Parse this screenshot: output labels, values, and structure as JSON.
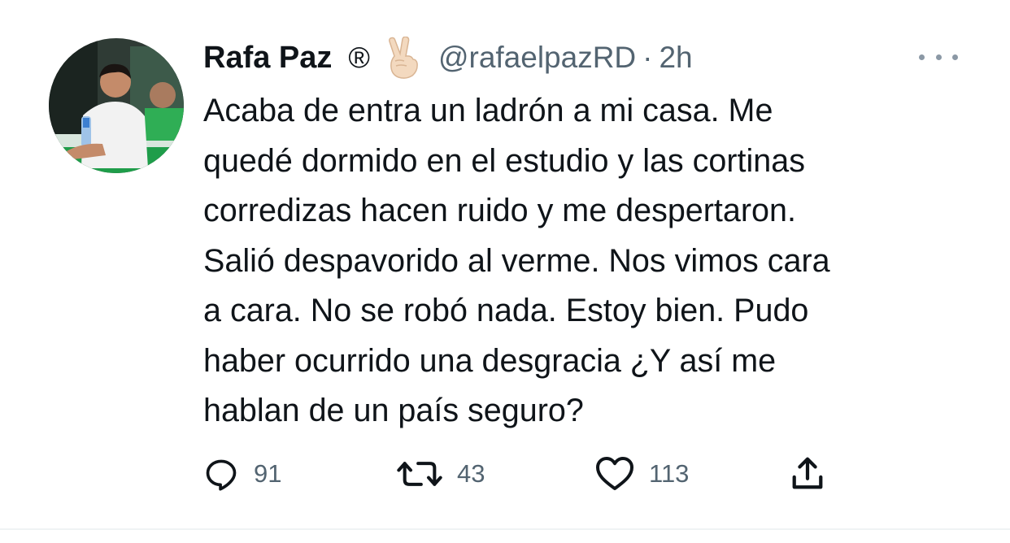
{
  "author": {
    "display_name": "Rafa Paz",
    "registered_mark": "®",
    "handle": "@rafaelpazRD",
    "separator": "·",
    "time": "2h"
  },
  "tweet": {
    "lines": [
      "Acaba de entra un ladrón a mi casa. Me",
      "quedé dormido en el estudio y las cortinas",
      "corredizas hacen ruido y me despertaron.",
      "Salió despavorido al verme. Nos vimos cara",
      "a cara. No se robó nada. Estoy bien. Pudo",
      "haber ocurrido una desgracia ¿Y así me",
      "hablan de un país seguro?"
    ]
  },
  "actions": {
    "replies": "91",
    "retweets": "43",
    "likes": "113"
  },
  "icons": {
    "more": "more-options-icon",
    "reply": "reply-icon",
    "retweet": "retweet-icon",
    "like": "heart-icon",
    "share": "share-icon",
    "emoji": "victory-hand-emoji"
  },
  "colors": {
    "text": "#0f1419",
    "secondary": "#536471",
    "background": "#ffffff"
  }
}
